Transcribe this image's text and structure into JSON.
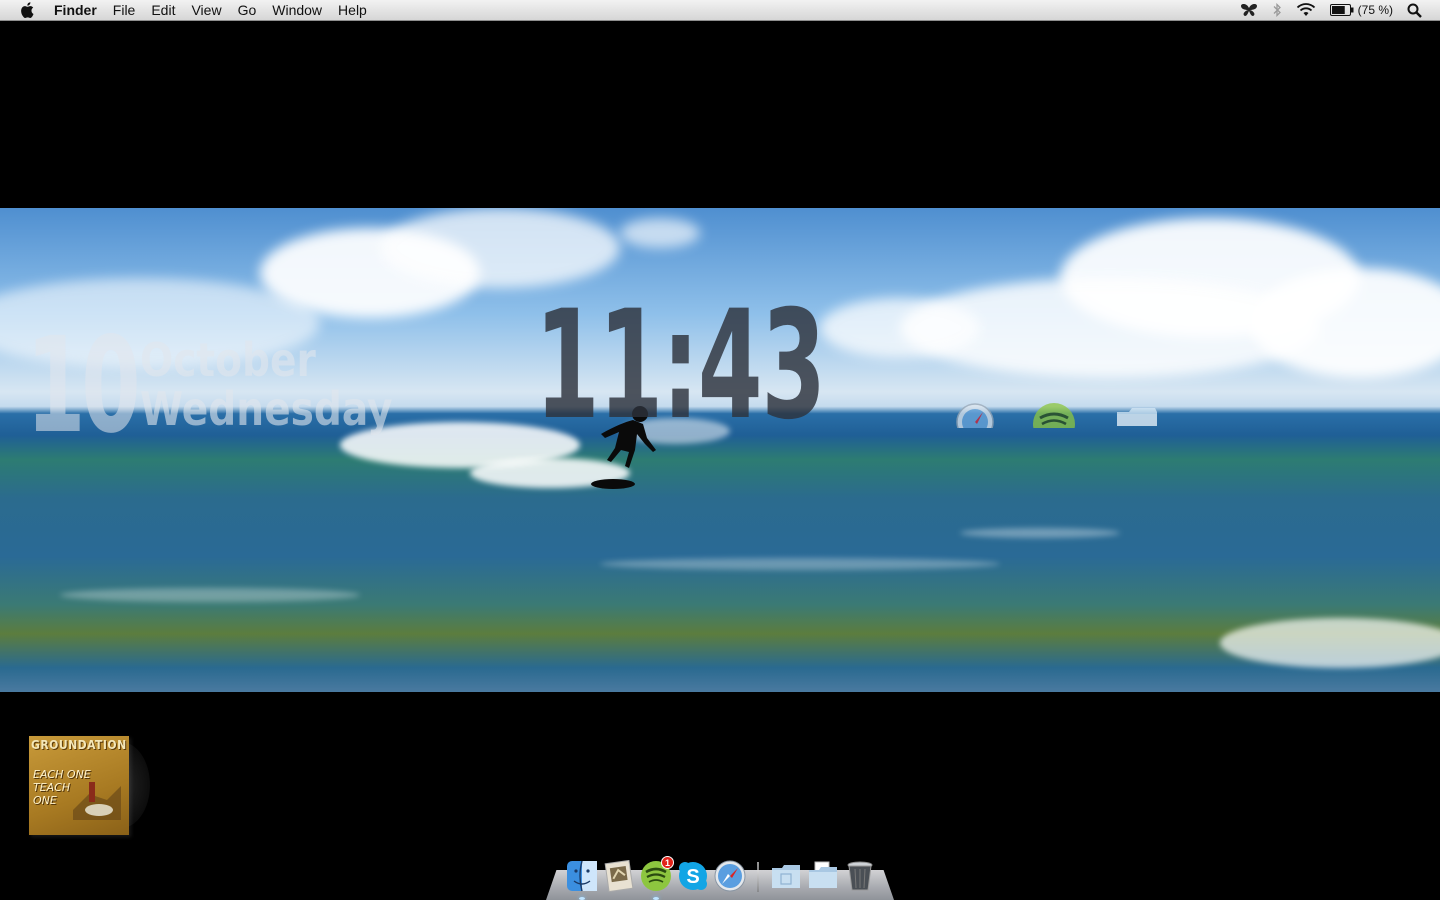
{
  "menubar": {
    "apple_icon": "apple-logo-icon",
    "app_name": "Finder",
    "items": [
      "File",
      "Edit",
      "View",
      "Go",
      "Window",
      "Help"
    ],
    "status": {
      "icons": [
        "butterfly-icon",
        "bluetooth-icon",
        "wifi-icon",
        "battery-icon",
        "spotlight-search-icon"
      ],
      "battery_text": "(75 %)",
      "battery_level": 0.75
    }
  },
  "desktop": {
    "clock": {
      "time": "11:43"
    },
    "date": {
      "day": "10",
      "month": "October",
      "weekday": "Wednesday"
    },
    "floating_icons": [
      "safari-icon",
      "spotify-icon",
      "folder-icon"
    ]
  },
  "now_playing": {
    "artist": "GROUNDATION",
    "album_line1": "EACH ONE",
    "album_line2": "TEACH ONE"
  },
  "dock": {
    "apps": [
      {
        "name": "Finder",
        "icon": "finder-icon",
        "running": true
      },
      {
        "name": "Mail",
        "icon": "mail-icon",
        "running": false
      },
      {
        "name": "Spotify",
        "icon": "spotify-icon",
        "running": true,
        "badge": "1"
      },
      {
        "name": "Skype",
        "icon": "skype-icon",
        "running": false
      },
      {
        "name": "Safari",
        "icon": "safari-icon",
        "running": false
      }
    ],
    "stacks": [
      {
        "name": "Applications",
        "icon": "folder-icon"
      },
      {
        "name": "Documents",
        "icon": "documents-folder-icon"
      },
      {
        "name": "Trash",
        "icon": "trash-icon"
      }
    ]
  },
  "colors": {
    "menubar": "#e0e0e0",
    "desktop_background": "#000000",
    "badge": "#e2231a"
  }
}
